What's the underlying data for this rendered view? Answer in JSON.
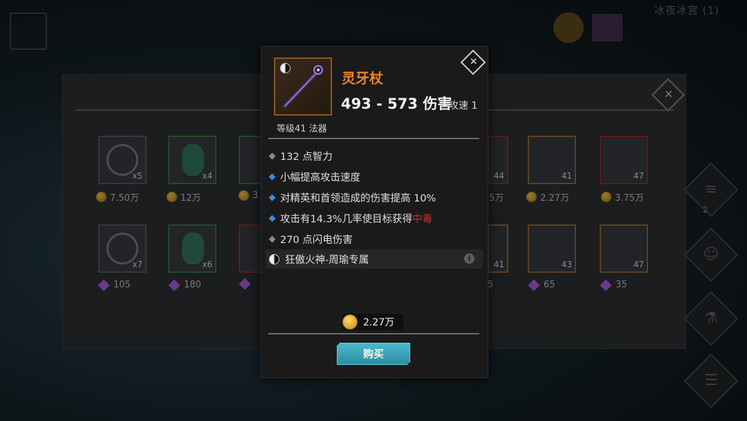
{
  "background": {
    "location_title": "冰夜冰宫 (1)",
    "shop_close": "✕",
    "top_row": [
      {
        "count": "x5",
        "price": "7.50万",
        "currency": "coin"
      },
      {
        "count": "x4",
        "price": "12万",
        "currency": "coin"
      },
      {
        "count": "",
        "price": "3",
        "currency": "coin"
      },
      {
        "count": "44",
        "price": "5万",
        "currency": "coin"
      },
      {
        "count": "41",
        "price": "2.27万",
        "currency": "coin"
      },
      {
        "count": "47",
        "price": "3.75万",
        "currency": "coin"
      }
    ],
    "bottom_row": [
      {
        "count": "x7",
        "price": "105",
        "currency": "gem"
      },
      {
        "count": "x6",
        "price": "180",
        "currency": "gem"
      },
      {
        "count": "",
        "price": "",
        "currency": "gem"
      },
      {
        "count": "41",
        "price": "5",
        "currency": "gem"
      },
      {
        "count": "43",
        "price": "65",
        "currency": "gem"
      },
      {
        "count": "47",
        "price": "35",
        "currency": "gem"
      }
    ],
    "nav_badge": "2"
  },
  "tooltip": {
    "close_icon": "✕",
    "item_name": "灵牙杖",
    "damage": "493 - 573 伤害",
    "attack_speed": "攻速 1",
    "level_type": "等级41 法器",
    "stats": [
      {
        "bullet": "grey",
        "text": "132 点智力"
      },
      {
        "bullet": "blue",
        "text": "小幅提高攻击速度"
      },
      {
        "bullet": "blue",
        "text": "对精英和首领造成的伤害提高 10%"
      },
      {
        "bullet": "blue",
        "text": "攻击有14.3%几率使目标获得",
        "highlight": "中毒"
      },
      {
        "bullet": "grey",
        "text": "270 点闪电伤害"
      }
    ],
    "set_label": "狂傲火神-周瑜专属",
    "info_icon": "i",
    "price": "2.27万",
    "buy_label": "购买"
  },
  "colors": {
    "item_name": "#e8862a",
    "highlight_red": "#e02020",
    "buy_button": "#3aa6bb",
    "blue_bullet": "#3a8de0"
  }
}
